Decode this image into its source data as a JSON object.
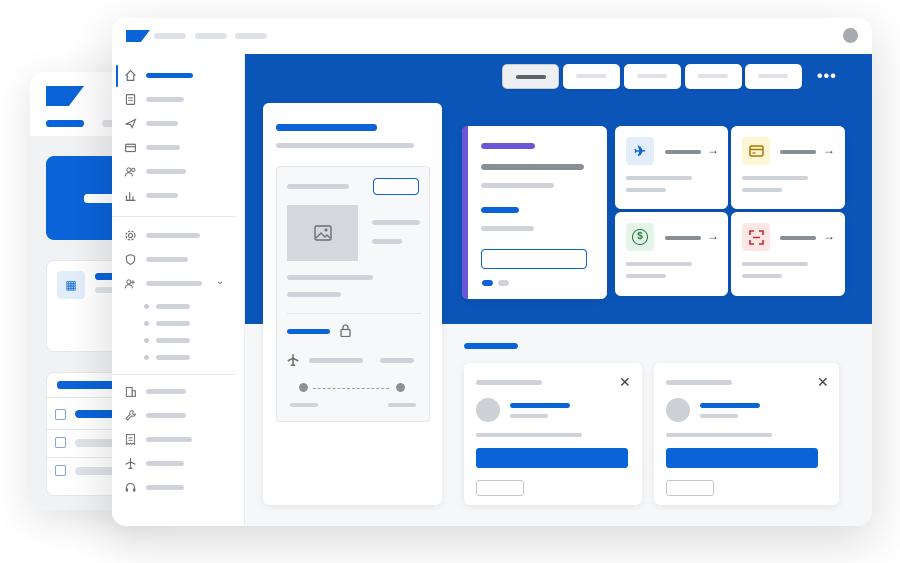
{
  "colors": {
    "accent": "#0b63d8",
    "hero": "#0b55b8",
    "purple_accent": "#6a57d8",
    "flight_tile": "#e3eefc",
    "card_tile": "#fff6d6",
    "money_tile": "#e4f4e8",
    "scan_tile": "#fde6e6"
  },
  "topbar": {
    "logo": "brand-logo",
    "avatar": "profile-avatar"
  },
  "toolbar": {
    "buttons": [
      "tab-1",
      "tab-2",
      "tab-3",
      "tab-4",
      "tab-5"
    ],
    "more_label": "•••"
  },
  "sidebar": {
    "icons": [
      "home-icon",
      "document-icon",
      "plane-icon",
      "card-icon",
      "people-icon",
      "chart-icon",
      "settings-icon",
      "shield-icon",
      "users-icon",
      "building-icon",
      "wrench-icon",
      "receipt-icon",
      "airplane-icon",
      "headset-icon"
    ],
    "expand_icon": "chevron-down-icon"
  },
  "quick_actions": {
    "flight_glyph": "✈",
    "money_glyph": "$",
    "arrow_glyph": "→"
  },
  "notifications": {
    "close_glyph": "✕"
  }
}
